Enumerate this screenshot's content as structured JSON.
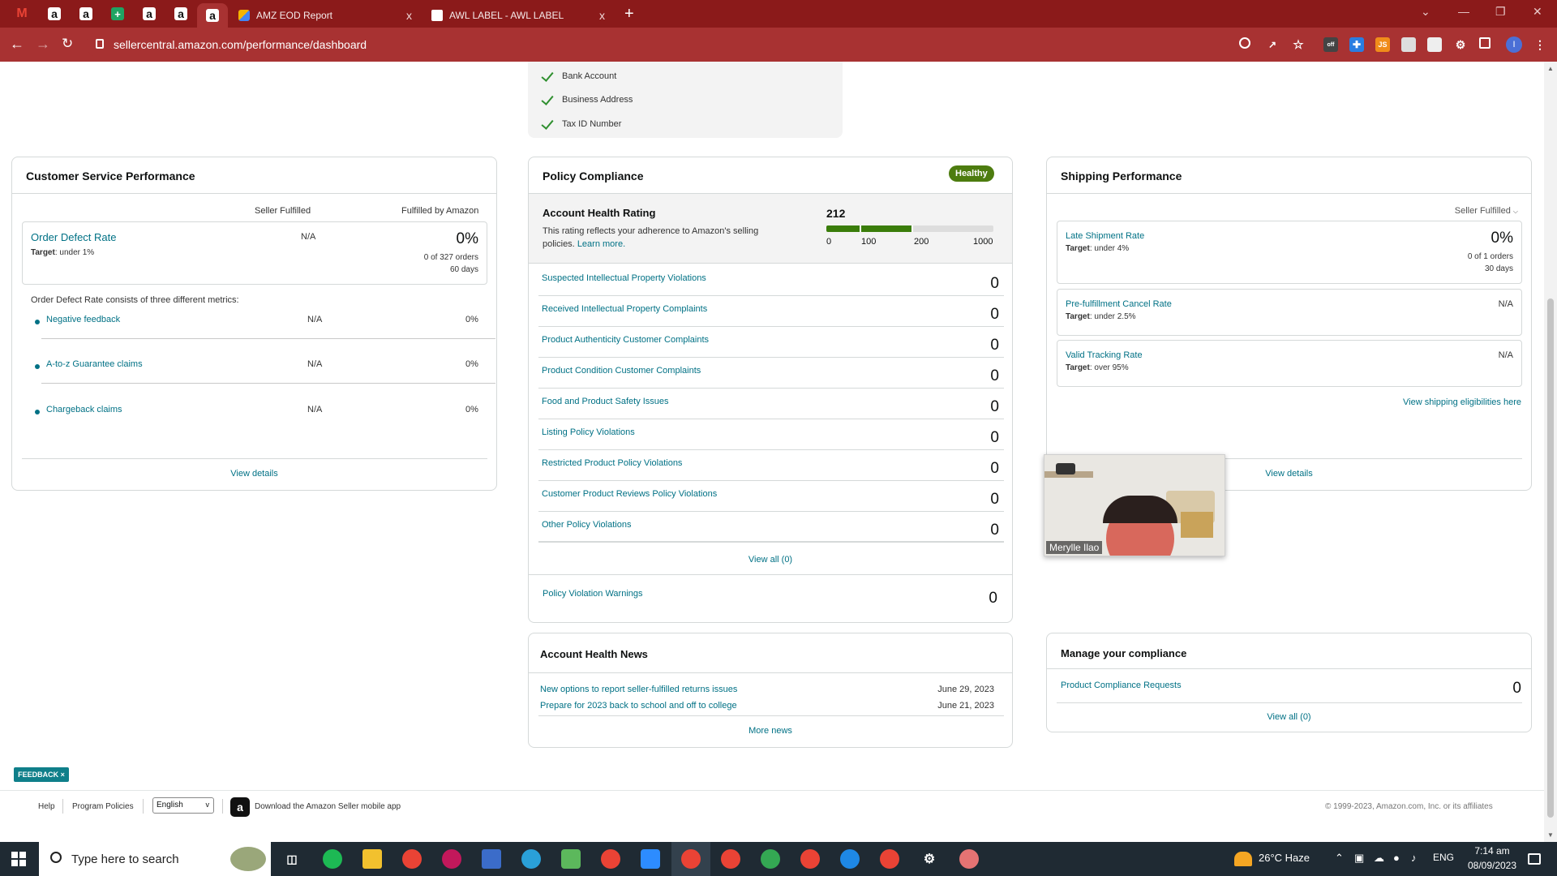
{
  "browser": {
    "tabs": [
      {
        "label": "AMZ EOD Report",
        "close": "x"
      },
      {
        "label": "AWL LABEL - AWL LABEL",
        "close": "x"
      }
    ],
    "pinned": [
      "M",
      "a",
      "a",
      "+",
      "a",
      "a",
      "a"
    ],
    "new_tab": "+",
    "url": "sellercentral.amazon.com/performance/dashboard",
    "profile_initial": "I",
    "ext_labels": {
      "js": "JS",
      "off": "off"
    }
  },
  "verification": {
    "items": [
      "Bank Account",
      "Business Address",
      "Tax ID Number"
    ]
  },
  "customer_service": {
    "title": "Customer Service Performance",
    "col_seller": "Seller Fulfilled",
    "col_fba": "Fulfilled by Amazon",
    "odr": {
      "name": "Order Defect Rate",
      "target_label": "Target",
      "target": ": under 1%",
      "seller_value": "N/A",
      "fba_value": "0%",
      "orders": "0 of 327 orders",
      "period": "60 days"
    },
    "intro": "Order Defect Rate consists of three different metrics:",
    "metrics": [
      {
        "name": "Negative feedback",
        "seller": "N/A",
        "fba": "0%"
      },
      {
        "name": "A-to-z Guarantee claims",
        "seller": "N/A",
        "fba": "0%"
      },
      {
        "name": "Chargeback claims",
        "seller": "N/A",
        "fba": "0%"
      }
    ],
    "view_details": "View details"
  },
  "policy": {
    "title": "Policy Compliance",
    "status": "Healthy",
    "ahr_title": "Account Health Rating",
    "ahr_desc": "This rating reflects your adherence to Amazon's selling policies.",
    "learn_more": "Learn more.",
    "rating": "212",
    "scale_labels": [
      "0",
      "100",
      "200",
      "1000"
    ],
    "rating_fraction_of_scale": 0.212,
    "rows": [
      {
        "label": "Suspected Intellectual Property Violations",
        "count": "0"
      },
      {
        "label": "Received Intellectual Property Complaints",
        "count": "0"
      },
      {
        "label": "Product Authenticity Customer Complaints",
        "count": "0"
      },
      {
        "label": "Product Condition Customer Complaints",
        "count": "0"
      },
      {
        "label": "Food and Product Safety Issues",
        "count": "0"
      },
      {
        "label": "Listing Policy Violations",
        "count": "0"
      },
      {
        "label": "Restricted Product Policy Violations",
        "count": "0"
      },
      {
        "label": "Customer Product Reviews Policy Violations",
        "count": "0"
      },
      {
        "label": "Other Policy Violations",
        "count": "0"
      }
    ],
    "view_all": "View all (0)",
    "warnings_label": "Policy Violation Warnings",
    "warnings_count": "0"
  },
  "news": {
    "title": "Account Health News",
    "items": [
      {
        "title": "New options to report seller-fulfilled returns issues",
        "date": "June 29, 2023"
      },
      {
        "title": "Prepare for 2023 back to school and off to college",
        "date": "June 21, 2023"
      }
    ],
    "more": "More news"
  },
  "shipping": {
    "title": "Shipping Performance",
    "filter": "Seller Fulfilled",
    "metrics": [
      {
        "name": "Late Shipment Rate",
        "target_label": "Target",
        "target": ": under 4%",
        "value": "0%",
        "orders": "0 of 1 orders",
        "period": "30 days"
      },
      {
        "name": "Pre-fulfillment Cancel Rate",
        "target_label": "Target",
        "target": ": under 2.5%",
        "value": "N/A"
      },
      {
        "name": "Valid Tracking Rate",
        "target_label": "Target",
        "target": ": over 95%",
        "value": "N/A"
      }
    ],
    "eligibility_link": "View shipping eligibilities here",
    "view_details": "View details"
  },
  "webcam": {
    "name": "Merylle Ilao"
  },
  "compliance": {
    "title": "Manage your compliance",
    "row_label": "Product Compliance Requests",
    "row_count": "0",
    "view_all": "View all (0)"
  },
  "footer": {
    "help": "Help",
    "policies": "Program Policies",
    "language": "English",
    "app_text": "Download the Amazon Seller mobile app",
    "copyright": "© 1999-2023, Amazon.com, Inc. or its affiliates",
    "feedback": "FEEDBACK"
  },
  "taskbar": {
    "search_placeholder": "Type here to search",
    "weather": "26°C  Haze",
    "lang": "ENG",
    "time": "7:14 am",
    "date": "08/09/2023"
  },
  "colors": {
    "chrome": "#8b1a1a",
    "link": "#007185",
    "healthy": "#4d7c0f",
    "rating_bar": "#3a7d0a"
  }
}
